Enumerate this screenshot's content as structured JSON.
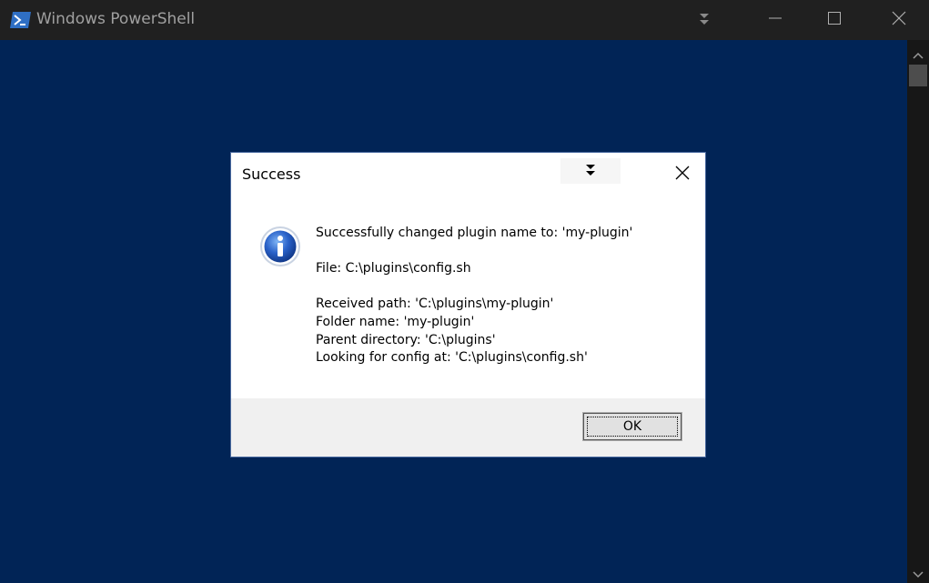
{
  "window": {
    "title": "Windows PowerShell",
    "background_color": "#012456",
    "titlebar_color": "#202020",
    "icons": {
      "app": "powershell-icon",
      "menu": "double-chevron-down-icon",
      "minimize": "minimize-icon",
      "maximize": "maximize-icon",
      "close": "close-icon"
    }
  },
  "scrollbar": {
    "up_icon": "chevron-up-icon",
    "down_icon": "chevron-down-icon"
  },
  "dialog": {
    "title": "Success",
    "icon": "info-icon",
    "menu_icon": "double-chevron-down-icon",
    "close_icon": "close-icon",
    "message": {
      "line1": "Successfully changed plugin name to: 'my-plugin'",
      "line2": "File: C:\\plugins\\config.sh",
      "line3": "Received path: 'C:\\plugins\\my-plugin'",
      "line4": "Folder name: 'my-plugin'",
      "line5": "Parent directory: 'C:\\plugins'",
      "line6": "Looking for config at: 'C:\\plugins\\config.sh'"
    },
    "ok_label": "OK"
  }
}
